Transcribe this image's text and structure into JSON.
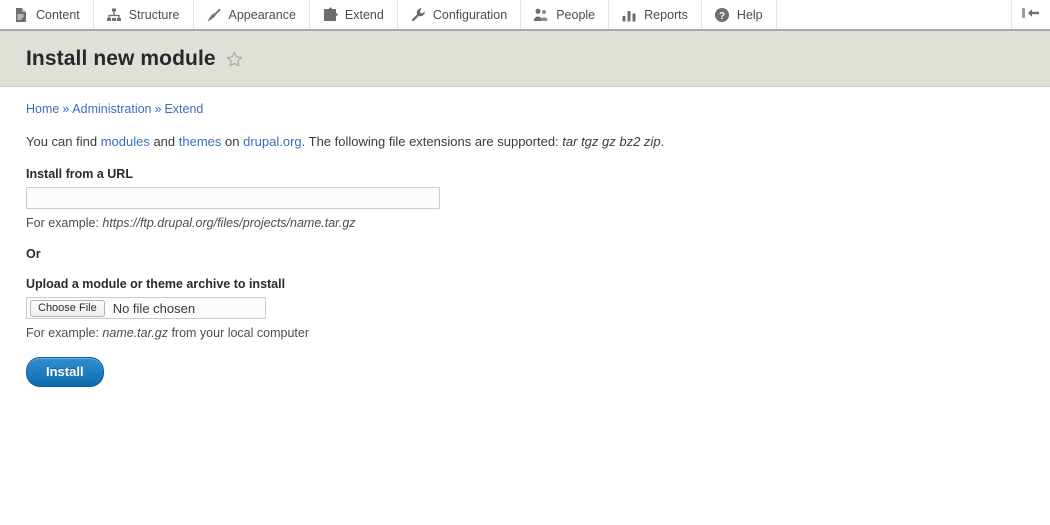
{
  "toolbar": {
    "items": [
      {
        "label": "Content",
        "icon": "document-icon"
      },
      {
        "label": "Structure",
        "icon": "sitemap-icon"
      },
      {
        "label": "Appearance",
        "icon": "paintbrush-icon"
      },
      {
        "label": "Extend",
        "icon": "puzzle-piece-icon"
      },
      {
        "label": "Configuration",
        "icon": "wrench-icon"
      },
      {
        "label": "People",
        "icon": "people-icon"
      },
      {
        "label": "Reports",
        "icon": "bar-chart-icon"
      },
      {
        "label": "Help",
        "icon": "question-mark-icon"
      }
    ],
    "collapse_icon": "collapse-toolbar-icon"
  },
  "page": {
    "title": "Install new module",
    "bookmark_icon": "star-outline-icon"
  },
  "breadcrumb": {
    "items": [
      "Home",
      "Administration",
      "Extend"
    ],
    "separator": "»"
  },
  "intro": {
    "prefix": "You can find ",
    "link_modules": "modules",
    "mid1": " and ",
    "link_themes": "themes",
    "mid2": " on ",
    "link_drupal": "drupal.org",
    "mid3": ". The following file extensions are supported: ",
    "extensions": "tar tgz gz bz2 zip",
    "suffix": "."
  },
  "url_field": {
    "label": "Install from a URL",
    "value": "",
    "placeholder": "",
    "help_prefix": "For example: ",
    "help_example": "https://ftp.drupal.org/files/projects/name.tar.gz"
  },
  "or_separator": "Or",
  "file_field": {
    "label": "Upload a module or theme archive to install",
    "button_label": "Choose File",
    "file_name": "No file chosen",
    "help_prefix": "For example: ",
    "help_example": "name.tar.gz",
    "help_suffix": " from your local computer"
  },
  "submit": {
    "label": "Install"
  },
  "colors": {
    "link_blue": "#3b6ec4",
    "title_band": "#e0e0d9",
    "button_blue": "#1b7cc0",
    "toolbar_border": "#aaaaa6"
  }
}
